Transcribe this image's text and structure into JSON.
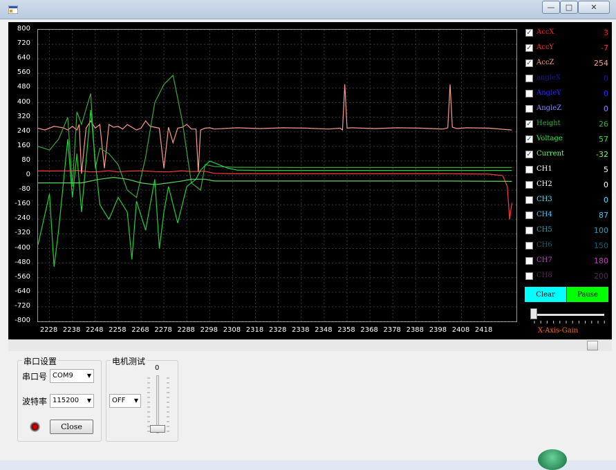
{
  "window": {
    "title": "",
    "min_label": "—",
    "max_label": "□",
    "close_label": "✕"
  },
  "chart_data": {
    "type": "line",
    "title": "",
    "xlabel": "",
    "ylabel": "",
    "xlim": [
      2223,
      2432
    ],
    "ylim": [
      -800,
      800
    ],
    "y_ticks": [
      "800",
      "720",
      "640",
      "560",
      "480",
      "400",
      "320",
      "240",
      "160",
      "80",
      "0",
      "-80",
      "-160",
      "-240",
      "-320",
      "-400",
      "-480",
      "-560",
      "-640",
      "-720",
      "-800"
    ],
    "x_ticks": [
      "2228",
      "2238",
      "2248",
      "2258",
      "2268",
      "2278",
      "2288",
      "2298",
      "2308",
      "2318",
      "2328",
      "2338",
      "2348",
      "2358",
      "2368",
      "2378",
      "2388",
      "2398",
      "2408",
      "2418"
    ],
    "grid": true,
    "background": "#000000",
    "series": [
      {
        "name": "AccX",
        "color": "#ff3b3b",
        "x": [
          2223,
          2236,
          2240,
          2246,
          2250,
          2254,
          2258,
          2262,
          2268,
          2274,
          2280,
          2286,
          2290,
          2296,
          2300,
          2310,
          2330,
          2360,
          2400,
          2420,
          2426,
          2428,
          2429,
          2430
        ],
        "y": [
          25,
          25,
          28,
          20,
          22,
          26,
          20,
          24,
          26,
          22,
          20,
          26,
          22,
          24,
          12,
          10,
          10,
          10,
          10,
          8,
          0,
          -60,
          -240,
          -150
        ]
      },
      {
        "name": "AccZ",
        "color": "#ff9a8a",
        "x": [
          2223,
          2226,
          2230,
          2234,
          2236,
          2238,
          2240,
          2241,
          2242,
          2244,
          2246,
          2248,
          2250,
          2252,
          2254,
          2256,
          2258,
          2260,
          2262,
          2264,
          2266,
          2268,
          2270,
          2272,
          2274,
          2276,
          2278,
          2280,
          2282,
          2284,
          2286,
          2288,
          2290,
          2292,
          2293,
          2294,
          2296,
          2298,
          2300,
          2310,
          2320,
          2330,
          2340,
          2350,
          2355,
          2356,
          2357,
          2358,
          2360,
          2370,
          2380,
          2390,
          2400,
          2402,
          2403,
          2404,
          2406,
          2410,
          2420,
          2430
        ],
        "y": [
          260,
          250,
          270,
          262,
          250,
          270,
          250,
          280,
          10,
          260,
          300,
          260,
          280,
          40,
          280,
          265,
          270,
          255,
          280,
          265,
          250,
          260,
          300,
          270,
          265,
          260,
          40,
          265,
          180,
          260,
          265,
          280,
          255,
          255,
          20,
          250,
          260,
          262,
          255,
          262,
          258,
          262,
          260,
          255,
          260,
          250,
          500,
          260,
          262,
          258,
          262,
          260,
          255,
          262,
          500,
          265,
          258,
          262,
          260,
          250
        ]
      },
      {
        "name": "Height",
        "color": "#3aaa3a",
        "x": [
          2223,
          2228,
          2232,
          2236,
          2238,
          2240,
          2242,
          2246,
          2248,
          2250,
          2254,
          2258,
          2262,
          2266,
          2270,
          2274,
          2278,
          2282,
          2286,
          2290,
          2294,
          2296,
          2300,
          2310,
          2320,
          2340,
          2380,
          2430
        ],
        "y": [
          160,
          140,
          200,
          320,
          -60,
          350,
          280,
          450,
          40,
          150,
          120,
          60,
          -80,
          -120,
          100,
          400,
          500,
          550,
          300,
          -40,
          -80,
          60,
          50,
          45,
          45,
          44,
          44,
          44
        ]
      },
      {
        "name": "Voltage",
        "color": "#1ed23a",
        "x": [
          2223,
          2228,
          2230,
          2232,
          2236,
          2238,
          2240,
          2242,
          2246,
          2248,
          2250,
          2254,
          2258,
          2262,
          2264,
          2266,
          2270,
          2274,
          2276,
          2278,
          2280,
          2284,
          2288,
          2292,
          2294,
          2298,
          2302,
          2306,
          2310,
          2320,
          2340,
          2380,
          2430
        ],
        "y": [
          -380,
          -100,
          -500,
          -300,
          200,
          -120,
          120,
          -200,
          360,
          80,
          -160,
          -240,
          -120,
          -200,
          -460,
          -140,
          -300,
          -20,
          -400,
          -200,
          -60,
          -260,
          -60,
          -20,
          30,
          80,
          60,
          40,
          30,
          28,
          28,
          28,
          28
        ]
      },
      {
        "name": "Current",
        "color": "#5fd75f",
        "x": [
          2223,
          2236,
          2242,
          2250,
          2256,
          2262,
          2268,
          2274,
          2280,
          2286,
          2290,
          2296,
          2300,
          2320,
          2360,
          2400,
          2430
        ],
        "y": [
          -40,
          -40,
          -40,
          -20,
          -10,
          -20,
          -40,
          -50,
          -40,
          -30,
          -20,
          -20,
          -30,
          -30,
          -30,
          -30,
          -32
        ]
      }
    ]
  },
  "channels": [
    {
      "name": "AccX",
      "value": "3",
      "checked": true,
      "color": "#ff1a1a"
    },
    {
      "name": "AccY",
      "value": "-7",
      "checked": true,
      "color": "#ff2a2a"
    },
    {
      "name": "AccZ",
      "value": "254",
      "checked": true,
      "color": "#ff9a8a"
    },
    {
      "name": "angleX",
      "value": "0",
      "checked": false,
      "color": "#1a1a8a"
    },
    {
      "name": "AngleY",
      "value": "0",
      "checked": false,
      "color": "#2a2aff"
    },
    {
      "name": "AngleZ",
      "value": "0",
      "checked": false,
      "color": "#8a8aff"
    },
    {
      "name": "Height",
      "value": "26",
      "checked": true,
      "color": "#3aaa3a"
    },
    {
      "name": "Voltage",
      "value": "57",
      "checked": true,
      "color": "#2ae84a"
    },
    {
      "name": "Current",
      "value": "-32",
      "checked": true,
      "color": "#6aff6a"
    },
    {
      "name": "CH1",
      "value": "5",
      "checked": false,
      "color": "#ffffff"
    },
    {
      "name": "CH2",
      "value": "0",
      "checked": false,
      "color": "#ffffff"
    },
    {
      "name": "CH3",
      "value": "0",
      "checked": false,
      "color": "#40e0ff"
    },
    {
      "name": "CH4",
      "value": "87",
      "checked": false,
      "color": "#40c8ff"
    },
    {
      "name": "CH5",
      "value": "100",
      "checked": false,
      "color": "#2aa0b8"
    },
    {
      "name": "CH6",
      "value": "150",
      "checked": false,
      "color": "#1a6070"
    },
    {
      "name": "CH7",
      "value": "180",
      "checked": false,
      "color": "#c040c0"
    },
    {
      "name": "CH8",
      "value": "200",
      "checked": false,
      "color": "#5a2a5a"
    }
  ],
  "controls": {
    "clear_label": "Clear",
    "pause_label": "Pause",
    "gain_label": "X-Axis-Gain",
    "gain_level": 0
  },
  "serial": {
    "group_title": "串口设置",
    "port_label": "串口号",
    "port_value": "COM9",
    "baud_label": "波特率",
    "baud_value": "115200",
    "close_label": "Close"
  },
  "motor": {
    "group_title": "电机测试",
    "state_value": "OFF",
    "slider_value": "0"
  }
}
